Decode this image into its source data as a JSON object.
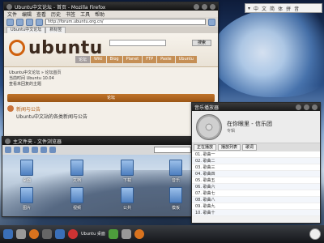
{
  "top_panel": {
    "items": [
      "▾",
      "中",
      "文",
      "简",
      "体",
      "拼",
      "音"
    ]
  },
  "firefox": {
    "title": "Ubuntu中文论坛 - 首页 - Mozilla Firefox",
    "menu": [
      "文件",
      "编辑",
      "查看",
      "历史",
      "书签",
      "工具",
      "帮助"
    ],
    "url": "http://forum.ubuntu.org.cn/",
    "tabs": [
      "Ubuntu中文论坛",
      "新标签"
    ],
    "logo": "ubuntu",
    "search_placeholder": "",
    "search_btn": "搜索",
    "nav": [
      "论坛",
      "Wiki",
      "Blog",
      "Planet",
      "FTP",
      "Paste",
      "Ubuntu"
    ],
    "body_lines": [
      "Ubuntu中文论坛 » 论坛首页",
      "当前时间 Ubuntu 10.04",
      "查看未回复的主题"
    ],
    "orange_bar": "论坛",
    "post_title": "新闻与公告",
    "post_desc": "Ubuntu中文站的各类新闻与公告"
  },
  "file_manager": {
    "title": "主文件夹 - 文件浏览器",
    "files": [
      {
        "label": "桌面"
      },
      {
        "label": "文档"
      },
      {
        "label": "下载"
      },
      {
        "label": "音乐"
      },
      {
        "label": "图片"
      },
      {
        "label": "视频"
      },
      {
        "label": "公共"
      },
      {
        "label": "模板"
      }
    ]
  },
  "music_player": {
    "title": "音乐播放器",
    "track_title": "在你眼里 - 信乐团",
    "track_sub": "专辑",
    "tabs": [
      "正在播放",
      "播放列表",
      "歌词"
    ],
    "rows": [
      "01. 歌曲一",
      "02. 歌曲二",
      "03. 歌曲三",
      "04. 歌曲四",
      "05. 歌曲五",
      "06. 歌曲六",
      "07. 歌曲七",
      "08. 歌曲八",
      "09. 歌曲九",
      "10. 歌曲十"
    ]
  },
  "taskbar": {
    "label": "Ubuntu 桌面"
  }
}
